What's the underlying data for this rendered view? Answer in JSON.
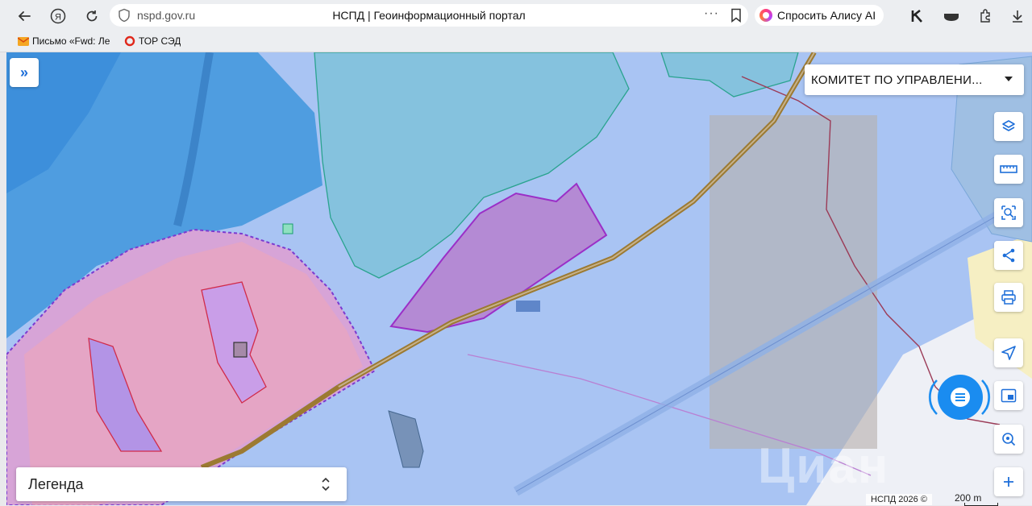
{
  "browser": {
    "back_icon": "arrow-left-icon",
    "yandex_icon": "yandex-logo-icon",
    "reload_icon": "reload-icon",
    "url": "nspd.gov.ru",
    "page_title": "НСПД | Геоинформационный портал",
    "more_label": "···",
    "alice_label": "Спросить Алису AI",
    "ext_icons": [
      "extension-k-icon",
      "vpn-icon",
      "extensions-icon",
      "download-icon"
    ]
  },
  "bookmarks": [
    {
      "label": "Письмо «Fwd: Ле",
      "icon": "mail-icon"
    },
    {
      "label": "ТОР СЭД",
      "icon": "circle-icon"
    }
  ],
  "map": {
    "expand_label": "»",
    "layer_select": "КОМИТЕТ ПО УПРАВЛЕНИ...",
    "legend_label": "Легенда",
    "attribution": "НСПД 2026 ©",
    "scale_label": "200 m",
    "watermark": "Циан",
    "tools": [
      "layers-icon",
      "ruler-icon",
      "area-select-icon",
      "share-icon",
      "print-icon",
      "locate-icon",
      "minimap-icon",
      "search-point-icon",
      "zoom-in-icon"
    ],
    "colors": {
      "water": "#4a9be0",
      "forest": "#86c1dc",
      "zone": "#aac6f4",
      "residential": "#e7a9c3",
      "road": "#8a6a2a",
      "parcel": "#b47bd8"
    }
  }
}
